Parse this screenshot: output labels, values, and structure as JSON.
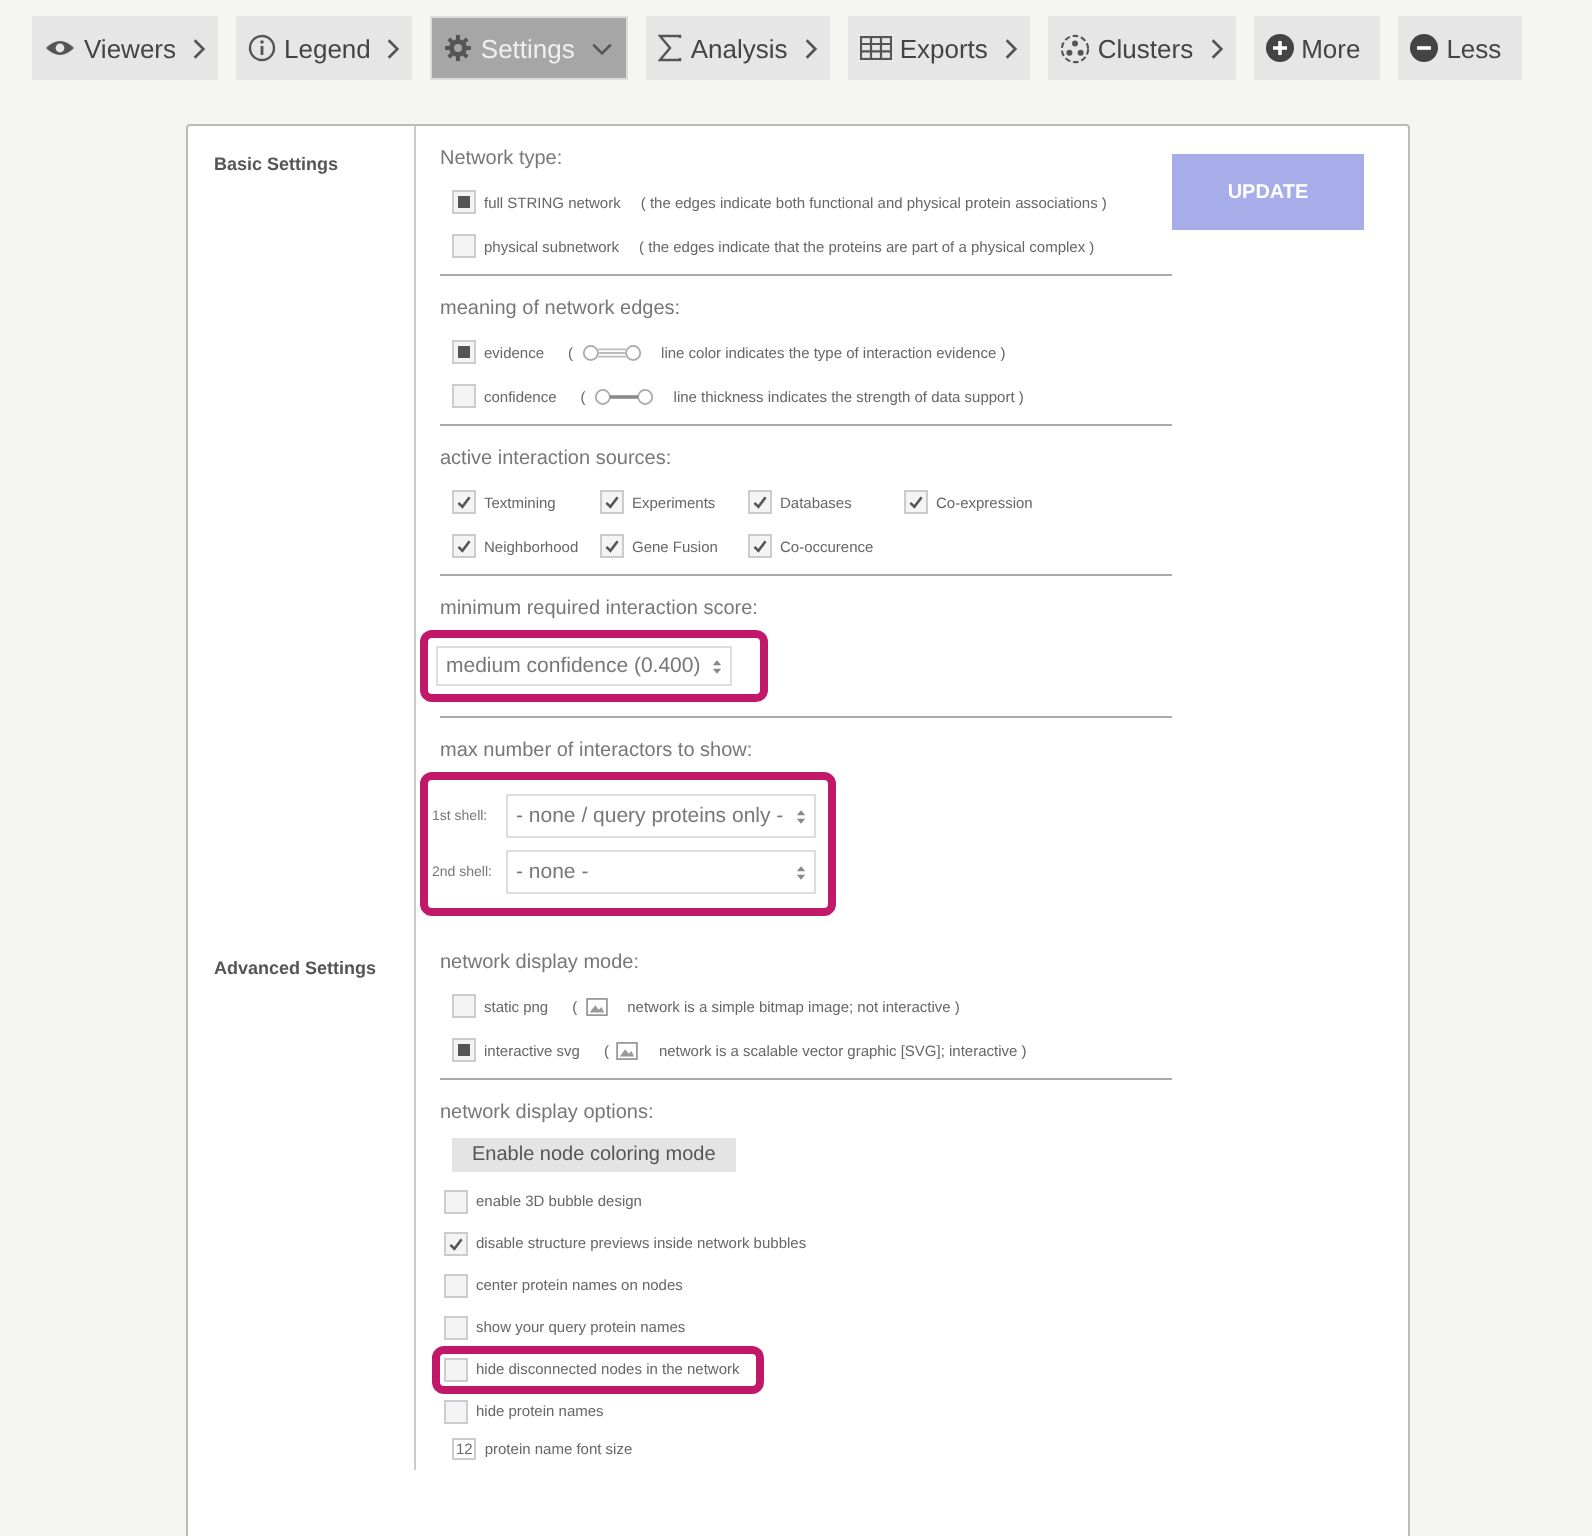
{
  "toolbar": [
    {
      "label": "Viewers",
      "selected": false
    },
    {
      "label": "Legend",
      "selected": false
    },
    {
      "label": "Settings",
      "selected": true
    },
    {
      "label": "Analysis",
      "selected": false
    },
    {
      "label": "Exports",
      "selected": false
    },
    {
      "label": "Clusters",
      "selected": false
    },
    {
      "label": "More",
      "selected": false
    },
    {
      "label": "Less",
      "selected": false
    }
  ],
  "update_button": {
    "label": "UPDATE"
  },
  "sections": [
    {
      "label": "Basic Settings",
      "groups": [
        {
          "kind": "options",
          "heading": "Network type:",
          "items": [
            {
              "label": "full STRING network",
              "checked": true,
              "note": "( the edges indicate both functional and physical protein associations )"
            },
            {
              "label": "physical subnetwork",
              "checked": false,
              "note": "( the edges indicate that the proteins are part of a physical complex )"
            }
          ]
        },
        {
          "kind": "edges",
          "heading": "meaning of network edges:",
          "items": [
            {
              "label": "evidence",
              "checked": true,
              "note_open": "(",
              "note": "line color indicates the type of interaction evidence )"
            },
            {
              "label": "confidence",
              "checked": false,
              "note_open": "(",
              "note": "line thickness indicates the strength of data support )"
            }
          ]
        },
        {
          "kind": "grid",
          "heading": "active interaction sources:",
          "rows": [
            [
              {
                "label": "Textmining",
                "checked": true
              },
              {
                "label": "Experiments",
                "checked": true
              },
              {
                "label": "Databases",
                "checked": true
              },
              {
                "label": "Co-expression",
                "checked": true
              }
            ],
            [
              {
                "label": "Neighborhood",
                "checked": true
              },
              {
                "label": "Gene Fusion",
                "checked": true
              },
              {
                "label": "Co-occurence",
                "checked": true
              }
            ]
          ]
        },
        {
          "kind": "select",
          "heading": "minimum required interaction score:",
          "value": "medium confidence (0.400)",
          "highlighted": true
        },
        {
          "kind": "shells",
          "heading": "max number of interactors to show:",
          "highlighted": true,
          "items": [
            {
              "label": "1st shell:",
              "value": "- none / query proteins only -"
            },
            {
              "label": "2nd shell:",
              "value": "- none -"
            }
          ]
        }
      ]
    },
    {
      "label": "Advanced Settings",
      "groups": [
        {
          "kind": "mode",
          "heading": "network display mode:",
          "items": [
            {
              "label": "static png",
              "checked": false,
              "note_open": "(",
              "note": "network is a simple bitmap image; not interactive )"
            },
            {
              "label": "interactive svg",
              "checked": true,
              "note_open": "(",
              "note": "network is a scalable vector graphic [SVG]; interactive )"
            }
          ]
        },
        {
          "kind": "display",
          "heading": "network display options:",
          "button": "Enable node coloring mode",
          "items": [
            {
              "kind": "checkbox",
              "label": "enable 3D bubble design",
              "checked": false,
              "highlighted": false
            },
            {
              "kind": "checkbox",
              "label": "disable structure previews inside network bubbles",
              "checked": true,
              "highlighted": false
            },
            {
              "kind": "checkbox",
              "label": "center protein names on nodes",
              "checked": false,
              "highlighted": false
            },
            {
              "kind": "checkbox",
              "label": "show your query protein names",
              "checked": false,
              "highlighted": false
            },
            {
              "kind": "checkbox",
              "label": "hide disconnected nodes in the network",
              "checked": false,
              "highlighted": true
            },
            {
              "kind": "checkbox",
              "label": "hide protein names",
              "checked": false,
              "highlighted": false
            },
            {
              "kind": "number",
              "value": "12",
              "label": "protein name font size"
            }
          ]
        }
      ]
    }
  ]
}
